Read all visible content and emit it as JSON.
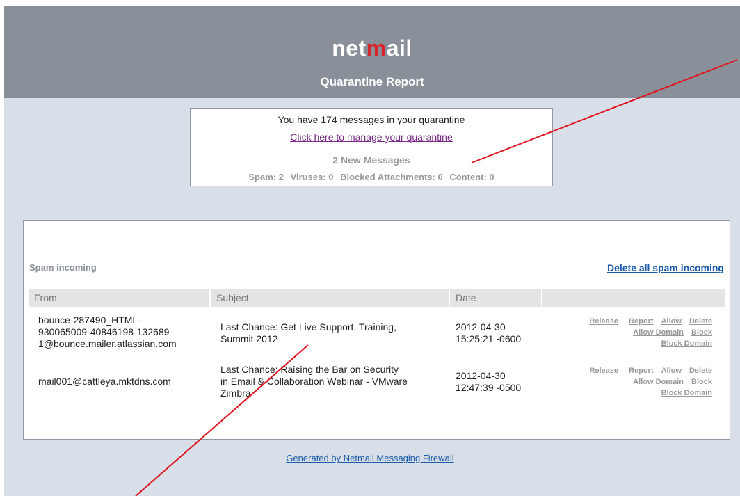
{
  "header": {
    "logo_prefix": "net",
    "logo_accent": "m",
    "logo_suffix": "ail",
    "title": "Quarantine Report"
  },
  "summary": {
    "count_text": "You have 174 messages in your quarantine",
    "manage_link": "Click here to manage your quarantine",
    "new_messages": "2 New Messages",
    "spam": "Spam: 2",
    "viruses": "Viruses: 0",
    "blocked": "Blocked Attachments: 0",
    "content": "Content: 0"
  },
  "panel": {
    "title": "Spam incoming",
    "delete_all": "Delete all spam incoming",
    "columns": {
      "from": "From",
      "subject": "Subject",
      "date": "Date"
    },
    "rows": [
      {
        "from_lines": [
          "bounce-287490_HTML-",
          "930065009-40846198-132689-",
          "1@bounce.mailer.atlassian.com"
        ],
        "subject_lines": [
          "Last Chance: Get Live Support, Training,",
          "Summit 2012"
        ],
        "date_lines": [
          "2012-04-30",
          "15:25:21 -0600"
        ]
      },
      {
        "from_lines": [
          "mail001@cattleya.mktdns.com"
        ],
        "subject_lines": [
          "Last Chance: Raising the Bar on Security",
          "in Email & Collaboration Webinar - VMware",
          "Zimbra"
        ],
        "date_lines": [
          "2012-04-30",
          "12:47:39 -0500"
        ]
      }
    ],
    "actions": {
      "release": "Release",
      "report": "Report",
      "allow": "Allow",
      "delete": "Delete",
      "allow_domain": "Allow Domain",
      "block": "Block",
      "block_domain": "Block Domain"
    }
  },
  "footer": {
    "link": "Generated by Netmail Messaging Firewall"
  },
  "colors": {
    "header_bg": "#8a9099",
    "page_bg": "#d8dfe9",
    "logo_accent": "#d6262c",
    "link_blue": "#1a5aa8",
    "annotation_red": "#e0141e"
  }
}
